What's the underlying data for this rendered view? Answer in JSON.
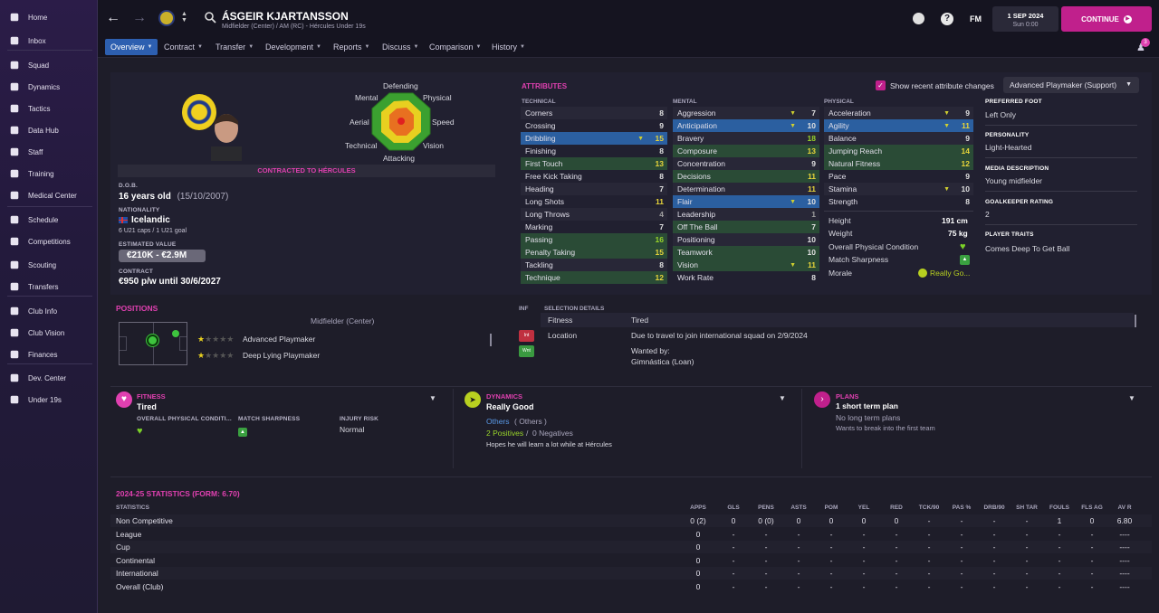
{
  "sidebar": {
    "items": [
      {
        "label": "Home",
        "icon": "home-icon"
      },
      {
        "label": "Inbox",
        "icon": "inbox-icon"
      },
      {
        "label": "Squad",
        "icon": "squad-icon"
      },
      {
        "label": "Dynamics",
        "icon": "dynamics-icon"
      },
      {
        "label": "Tactics",
        "icon": "tactics-icon"
      },
      {
        "label": "Data Hub",
        "icon": "data-hub-icon"
      },
      {
        "label": "Staff",
        "icon": "staff-icon"
      },
      {
        "label": "Training",
        "icon": "training-icon"
      },
      {
        "label": "Medical Center",
        "icon": "medical-icon"
      },
      {
        "label": "Schedule",
        "icon": "schedule-icon"
      },
      {
        "label": "Competitions",
        "icon": "trophy-icon"
      },
      {
        "label": "Scouting",
        "icon": "scouting-icon"
      },
      {
        "label": "Transfers",
        "icon": "transfers-icon"
      },
      {
        "label": "Club Info",
        "icon": "club-info-icon"
      },
      {
        "label": "Club Vision",
        "icon": "club-vision-icon"
      },
      {
        "label": "Finances",
        "icon": "finances-icon"
      },
      {
        "label": "Dev. Center",
        "icon": "dev-center-icon"
      },
      {
        "label": "Under 19s",
        "icon": "under19-icon"
      }
    ]
  },
  "header": {
    "player_name": "ÁSGEIR KJARTANSSON",
    "subtitle": "Midfielder (Center) / AM (RC) - Hércules Under 19s",
    "date": "1 SEP 2024",
    "time": "Sun 0:00",
    "fm_label": "FM",
    "continue_label": "CONTINUE",
    "notif_count": "3"
  },
  "tabs": [
    {
      "label": "Overview"
    },
    {
      "label": "Contract"
    },
    {
      "label": "Transfer"
    },
    {
      "label": "Development"
    },
    {
      "label": "Reports"
    },
    {
      "label": "Discuss"
    },
    {
      "label": "Comparison"
    },
    {
      "label": "History"
    }
  ],
  "profile": {
    "contract_banner": "CONTRACTED TO HÉRCULES",
    "dob_label": "D.O.B.",
    "dob_value": "16 years old",
    "dob_date": "(15/10/2007)",
    "nationality_label": "NATIONALITY",
    "nationality": "Icelandic",
    "caps": "6 U21 caps / 1 U21 goal",
    "value_label": "ESTIMATED VALUE",
    "value": "€210K - €2.9M",
    "contract_label": "CONTRACT",
    "contract": "€950 p/w until 30/6/2027"
  },
  "radar": {
    "labels": {
      "defending": "Defending",
      "physical": "Physical",
      "speed": "Speed",
      "vision": "Vision",
      "attacking": "Attacking",
      "technical": "Technical",
      "aerial": "Aerial",
      "mental": "Mental"
    }
  },
  "attributes": {
    "title": "ATTRIBUTES",
    "show_recent": "Show recent attribute changes",
    "role": "Advanced Playmaker (Support)",
    "technical_header": "TECHNICAL",
    "mental_header": "MENTAL",
    "physical_header": "PHYSICAL",
    "technical": [
      {
        "n": "Corners",
        "v": "8"
      },
      {
        "n": "Crossing",
        "v": "9"
      },
      {
        "n": "Dribbling",
        "v": "15"
      },
      {
        "n": "Finishing",
        "v": "8"
      },
      {
        "n": "First Touch",
        "v": "13"
      },
      {
        "n": "Free Kick Taking",
        "v": "8"
      },
      {
        "n": "Heading",
        "v": "7"
      },
      {
        "n": "Long Shots",
        "v": "11"
      },
      {
        "n": "Long Throws",
        "v": "4"
      },
      {
        "n": "Marking",
        "v": "7"
      },
      {
        "n": "Passing",
        "v": "16"
      },
      {
        "n": "Penalty Taking",
        "v": "15"
      },
      {
        "n": "Tackling",
        "v": "8"
      },
      {
        "n": "Technique",
        "v": "12"
      }
    ],
    "mental": [
      {
        "n": "Aggression",
        "v": "7"
      },
      {
        "n": "Anticipation",
        "v": "10"
      },
      {
        "n": "Bravery",
        "v": "18"
      },
      {
        "n": "Composure",
        "v": "13"
      },
      {
        "n": "Concentration",
        "v": "9"
      },
      {
        "n": "Decisions",
        "v": "11"
      },
      {
        "n": "Determination",
        "v": "11"
      },
      {
        "n": "Flair",
        "v": "10"
      },
      {
        "n": "Leadership",
        "v": "1"
      },
      {
        "n": "Off The Ball",
        "v": "7"
      },
      {
        "n": "Positioning",
        "v": "10"
      },
      {
        "n": "Teamwork",
        "v": "10"
      },
      {
        "n": "Vision",
        "v": "11"
      },
      {
        "n": "Work Rate",
        "v": "8"
      }
    ],
    "physical": [
      {
        "n": "Acceleration",
        "v": "9"
      },
      {
        "n": "Agility",
        "v": "11"
      },
      {
        "n": "Balance",
        "v": "9"
      },
      {
        "n": "Jumping Reach",
        "v": "14"
      },
      {
        "n": "Natural Fitness",
        "v": "12"
      },
      {
        "n": "Pace",
        "v": "9"
      },
      {
        "n": "Stamina",
        "v": "10"
      },
      {
        "n": "Strength",
        "v": "8"
      }
    ],
    "height_label": "Height",
    "height": "191 cm",
    "weight_label": "Weight",
    "weight": "75 kg",
    "opc_label": "Overall Physical Condition",
    "sharpness_label": "Match Sharpness",
    "morale_label": "Morale",
    "morale": "Really Go..."
  },
  "info": {
    "preferred_foot_label": "PREFERRED FOOT",
    "preferred_foot": "Left Only",
    "personality_label": "PERSONALITY",
    "personality": "Light-Hearted",
    "media_label": "MEDIA DESCRIPTION",
    "media": "Young midfielder",
    "gk_label": "GOALKEEPER RATING",
    "gk": "2",
    "traits_label": "PLAYER TRAITS",
    "traits": "Comes Deep To Get Ball"
  },
  "positions": {
    "title": "POSITIONS",
    "main": "Midfielder (Center)",
    "roles": [
      {
        "label": "Advanced Playmaker"
      },
      {
        "label": "Deep Lying Playmaker"
      }
    ]
  },
  "selection": {
    "inf_label": "INF",
    "title": "SELECTION DETAILS",
    "rows": [
      {
        "k": "Fitness",
        "v": "Tired"
      },
      {
        "k": "Location",
        "v": "Due to travel to join international squad on 2/9/2024",
        "badge": "Int"
      },
      {
        "k": "",
        "v": "Wanted by:",
        "v2": "Gimnástica (Loan)",
        "badge": "Wnt"
      }
    ]
  },
  "fitness_card": {
    "title": "FITNESS",
    "status": "Tired",
    "opc_label": "OVERALL PHYSICAL CONDITI...",
    "ms_label": "MATCH SHARPNESS",
    "injury_label": "INJURY RISK",
    "injury": "Normal"
  },
  "dynamics_card": {
    "title": "DYNAMICS",
    "status": "Really Good",
    "others": "Others",
    "others2": "( Others )",
    "positives": "2 Positives",
    "slash": "/",
    "negatives": "0 Negatives",
    "hopes": "Hopes he will learn a lot while at Hércules"
  },
  "plans_card": {
    "title": "PLANS",
    "status": "1 short term plan",
    "long": "No long term plans",
    "wants": "Wants to break into the first team"
  },
  "stats": {
    "title": "2024-25 STATISTICS (FORM: 6.70)",
    "header": "STATISTICS",
    "cols": [
      "APPS",
      "GLS",
      "PENS",
      "ASTS",
      "POM",
      "YEL",
      "RED",
      "TCK/90",
      "PAS %",
      "DRB/90",
      "SH TAR",
      "FOULS",
      "FLS AG",
      "AV R"
    ],
    "rows": [
      {
        "name": "Non Competitive",
        "vals": [
          "0 (2)",
          "0",
          "0 (0)",
          "0",
          "0",
          "0",
          "0",
          "-",
          "-",
          "-",
          "-",
          "1",
          "0",
          "6.80"
        ]
      },
      {
        "name": "League",
        "vals": [
          "0",
          "-",
          "-",
          "-",
          "-",
          "-",
          "-",
          "-",
          "-",
          "-",
          "-",
          "-",
          "-",
          "----"
        ]
      },
      {
        "name": "Cup",
        "vals": [
          "0",
          "-",
          "-",
          "-",
          "-",
          "-",
          "-",
          "-",
          "-",
          "-",
          "-",
          "-",
          "-",
          "----"
        ]
      },
      {
        "name": "Continental",
        "vals": [
          "0",
          "-",
          "-",
          "-",
          "-",
          "-",
          "-",
          "-",
          "-",
          "-",
          "-",
          "-",
          "-",
          "----"
        ]
      },
      {
        "name": "International",
        "vals": [
          "0",
          "-",
          "-",
          "-",
          "-",
          "-",
          "-",
          "-",
          "-",
          "-",
          "-",
          "-",
          "-",
          "----"
        ]
      },
      {
        "name": "Overall (Club)",
        "vals": [
          "0",
          "-",
          "-",
          "-",
          "-",
          "-",
          "-",
          "-",
          "-",
          "-",
          "-",
          "-",
          "-",
          "----"
        ]
      }
    ]
  },
  "colors": {
    "accent": "#e040b0",
    "tab_active": "#2d5fb0",
    "positive": "#9ad62a",
    "continue": "#c0208c"
  }
}
